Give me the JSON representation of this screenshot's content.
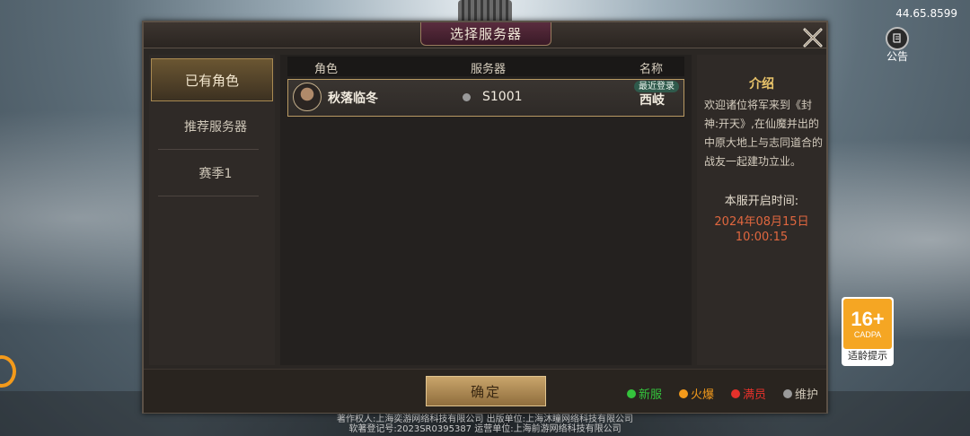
{
  "status": {
    "ip_text": "44.65.8599"
  },
  "notice": {
    "label": "公告",
    "icon": "scroll-icon"
  },
  "age_rating": {
    "number": "16+",
    "sub": "CADPA",
    "label": "适龄提示"
  },
  "dialog": {
    "title": "选择服务器",
    "close_icon": "close-icon",
    "sidebar": [
      {
        "label": "已有角色",
        "active": true
      },
      {
        "label": "推荐服务器",
        "active": false
      },
      {
        "label": "赛季1",
        "active": false
      }
    ],
    "table": {
      "headers": [
        "角色",
        "服务器",
        "名称"
      ],
      "rows": [
        {
          "character": "秋落临冬",
          "server_id": "S1001",
          "server_name": "西岐",
          "badge": "最近登录",
          "status_color": "#9a9a9a"
        }
      ]
    },
    "intro": {
      "title": "介绍",
      "body": "欢迎诸位将军来到《封神:开天》,在仙魔并出的中原大地上与志同道合的战友一起建功立业。",
      "time_label": "本服开启时间:",
      "date": "2024年08月15日",
      "time": "10:00:15"
    },
    "confirm_label": "确定",
    "legend": [
      {
        "label": "新服",
        "color": "#34c33c"
      },
      {
        "label": "火爆",
        "color": "#f39a1b"
      },
      {
        "label": "满员",
        "color": "#e5312b"
      },
      {
        "label": "维护",
        "color": "#9a9a9a"
      }
    ]
  },
  "copyright": {
    "line1": "著作权人:上海奕游网络科技有限公司 出版单位:上海沐瞳网络科技有限公司",
    "line2": "软著登记号:2023SR0395387 运营单位:上海前游网络科技有限公司"
  }
}
